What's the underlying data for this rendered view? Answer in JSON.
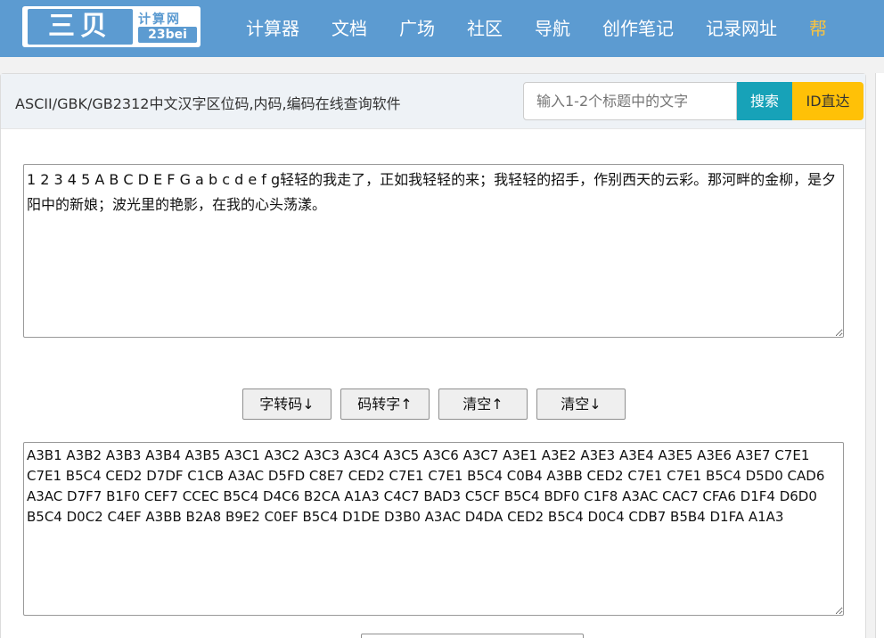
{
  "nav": {
    "logo_main": "三贝",
    "logo_sub": "计算网",
    "logo_domain": "23bei",
    "links": [
      "计算器",
      "文档",
      "广场",
      "社区",
      "导航",
      "创作笔记",
      "记录网址",
      "帮"
    ]
  },
  "panel": {
    "title": "ASCII/GBK/GB2312中文汉字区位码,内码,编码在线查询软件",
    "search_placeholder": "输入1-2个标题中的文字",
    "search_label": "搜索",
    "id_label": "ID直达"
  },
  "input_text": "1 2 3 4 5 A B C D E F G a b c d e f g轻轻的我走了，正如我轻轻的来；我轻轻的招手，作别西天的云彩。那河畔的金柳，是夕阳中的新娘；波光里的艳影，在我的心头荡漾。",
  "buttons": {
    "to_code": "字转码↓",
    "to_char": "码转字↑",
    "clear_up": "清空↑",
    "clear_down": "清空↓"
  },
  "output_text": "A3B1 A3B2 A3B3 A3B4 A3B5 A3C1 A3C2 A3C3 A3C4 A3C5 A3C6 A3C7 A3E1 A3E2 A3E3 A3E4 A3E5 A3E6 A3E7 C7E1 C7E1 B5C4 CED2 D7DF C1CB A3AC D5FD C8E7 CED2 C7E1 C7E1 B5C4 C0B4 A3BB CED2 C7E1 C7E1 B5C4 D5D0 CAD6 A3AC D7F7 B1F0 CEF7 CCEC B5C4 D4C6 B2CA A1A3 C4C7 BAD3 C5CF B5C4 BDF0 C1F8 A3AC CAC7 CFA6 D1F4 D6D0 B5C4 D0C2 C4EF A3BB B2A8 B9E2 C0EF B5C4 D1DE D3B0 A3AC D4DA CED2 B5C4 D0C4 CDB7 B5B4 D1FA A1A3"
}
